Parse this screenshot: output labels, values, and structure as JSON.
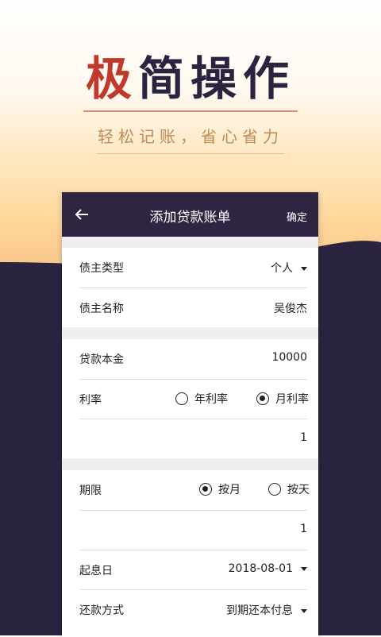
{
  "promo": {
    "headline": "极简操作",
    "slogan": "轻松记账，省心省力"
  },
  "card": {
    "title": "添加贷款账单",
    "back_icon": "arrow-left-icon",
    "confirm_label": "确定"
  },
  "form": {
    "creditor_type": {
      "label": "债主类型",
      "value": "个人"
    },
    "creditor_name": {
      "label": "债主名称",
      "value": "吴俊杰"
    },
    "principal": {
      "label": "贷款本金",
      "value": "10000"
    },
    "rate": {
      "label": "利率",
      "options": [
        {
          "label": "年利率",
          "selected": false
        },
        {
          "label": "月利率",
          "selected": true
        }
      ],
      "value": "1"
    },
    "term": {
      "label": "期限",
      "options": [
        {
          "label": "按月",
          "selected": true
        },
        {
          "label": "按天",
          "selected": false
        }
      ],
      "value": "1"
    },
    "start_date": {
      "label": "起息日",
      "value": "2018-08-01"
    },
    "repayment": {
      "label": "还款方式",
      "value": "到期还本付息"
    }
  },
  "colors": {
    "header_bg": "#2d2541",
    "wave": "#2b2440",
    "accent_red": "#c0392b"
  }
}
